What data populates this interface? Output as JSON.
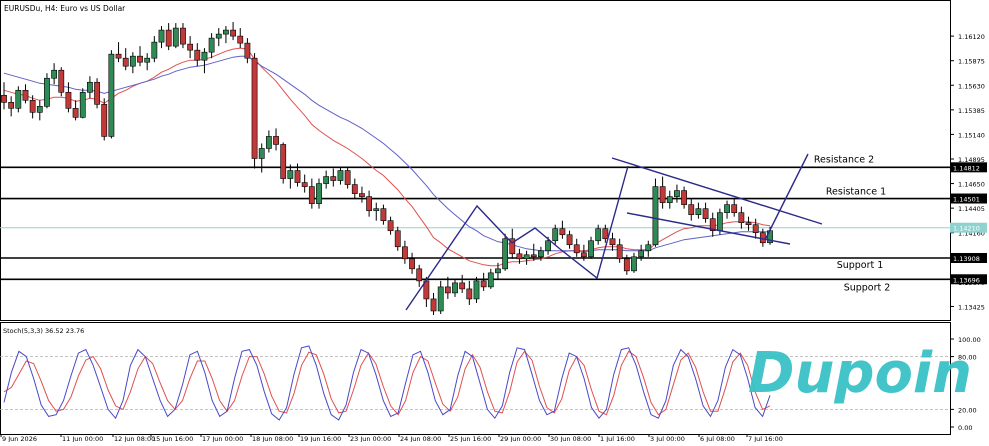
{
  "chart_data": {
    "type": "candlestick",
    "symbol_label": "EURUSDu, H4: Euro vs US Dollar",
    "price_axis": {
      "min": 1.1329,
      "max": 1.1646,
      "ticks": [
        "1.16120",
        "1.15875",
        "1.15630",
        "1.15385",
        "1.15140",
        "1.14895",
        "1.14650",
        "1.14405",
        "1.14160",
        "1.13915",
        "1.13670",
        "1.13425"
      ]
    },
    "x_labels": [
      "9 Jun 2026",
      "11 Jun 00:00",
      "12 Jun 08:00",
      "15 Jun 16:00",
      "17 Jun 00:00",
      "18 Jun 08:00",
      "19 Jun 16:00",
      "23 Jun 00:00",
      "24 Jun 08:00",
      "25 Jun 16:00",
      "29 Jun 00:00",
      "30 Jun 08:00",
      "1 Jul 16:00",
      "3 Jul 00:00",
      "6 Jul 08:00",
      "7 Jul 16:00"
    ],
    "levels": [
      {
        "name": "Resistance 2",
        "price": 1.14812,
        "label": "1.14812"
      },
      {
        "name": "Resistance 1",
        "price": 1.14501,
        "label": "1.14501"
      },
      {
        "name": "Support 1",
        "price": 1.13908,
        "label": "1.13908"
      },
      {
        "name": "Support 2",
        "price": 1.13696,
        "label": "1.13696"
      }
    ],
    "current_price": {
      "price": 1.1421,
      "label": "1.14210",
      "color": "#8fd3d0"
    },
    "candles_ohlc": [
      [
        1.1553,
        1.1566,
        1.1539,
        1.1546
      ],
      [
        1.1546,
        1.1552,
        1.1532,
        1.154
      ],
      [
        1.154,
        1.1562,
        1.1536,
        1.1558
      ],
      [
        1.1558,
        1.1564,
        1.1545,
        1.1548
      ],
      [
        1.1548,
        1.1553,
        1.153,
        1.1536
      ],
      [
        1.1536,
        1.1548,
        1.1528,
        1.1542
      ],
      [
        1.1542,
        1.1575,
        1.154,
        1.157
      ],
      [
        1.157,
        1.1585,
        1.1564,
        1.1578
      ],
      [
        1.1578,
        1.1581,
        1.1552,
        1.1556
      ],
      [
        1.1556,
        1.1566,
        1.1536,
        1.154
      ],
      [
        1.154,
        1.1548,
        1.1528,
        1.1531
      ],
      [
        1.1531,
        1.156,
        1.153,
        1.1556
      ],
      [
        1.1556,
        1.1572,
        1.155,
        1.1566
      ],
      [
        1.1566,
        1.157,
        1.154,
        1.1544
      ],
      [
        1.1544,
        1.155,
        1.1508,
        1.1512
      ],
      [
        1.1512,
        1.1598,
        1.151,
        1.1594
      ],
      [
        1.1594,
        1.1606,
        1.1586,
        1.159
      ],
      [
        1.159,
        1.16,
        1.1578,
        1.1582
      ],
      [
        1.1582,
        1.1596,
        1.1575,
        1.1592
      ],
      [
        1.1592,
        1.1602,
        1.1582,
        1.1586
      ],
      [
        1.1586,
        1.1595,
        1.1578,
        1.159
      ],
      [
        1.159,
        1.1612,
        1.1586,
        1.1606
      ],
      [
        1.1606,
        1.1622,
        1.16,
        1.1618
      ],
      [
        1.1618,
        1.1625,
        1.1598,
        1.1602
      ],
      [
        1.1602,
        1.1625,
        1.16,
        1.162
      ],
      [
        1.162,
        1.1625,
        1.16,
        1.1604
      ],
      [
        1.1604,
        1.1612,
        1.159,
        1.1598
      ],
      [
        1.1598,
        1.1605,
        1.1582,
        1.1588
      ],
      [
        1.1588,
        1.16,
        1.1575,
        1.1596
      ],
      [
        1.1596,
        1.1615,
        1.159,
        1.161
      ],
      [
        1.161,
        1.162,
        1.1602,
        1.1614
      ],
      [
        1.1614,
        1.1622,
        1.1605,
        1.1618
      ],
      [
        1.1618,
        1.1626,
        1.1608,
        1.1612
      ],
      [
        1.1612,
        1.162,
        1.16,
        1.1605
      ],
      [
        1.1605,
        1.161,
        1.1585,
        1.159
      ],
      [
        1.159,
        1.1595,
        1.148,
        1.149
      ],
      [
        1.149,
        1.1505,
        1.1476,
        1.15
      ],
      [
        1.15,
        1.1518,
        1.1496,
        1.1512
      ],
      [
        1.1512,
        1.152,
        1.1498,
        1.1504
      ],
      [
        1.1504,
        1.1506,
        1.1465,
        1.147
      ],
      [
        1.147,
        1.1484,
        1.146,
        1.1478
      ],
      [
        1.1478,
        1.1485,
        1.1462,
        1.1466
      ],
      [
        1.1466,
        1.1474,
        1.1456,
        1.1462
      ],
      [
        1.1462,
        1.147,
        1.144,
        1.1445
      ],
      [
        1.1445,
        1.147,
        1.144,
        1.1465
      ],
      [
        1.1465,
        1.1478,
        1.146,
        1.1472
      ],
      [
        1.1472,
        1.148,
        1.1462,
        1.1468
      ],
      [
        1.1468,
        1.1482,
        1.1464,
        1.1478
      ],
      [
        1.1478,
        1.1482,
        1.146,
        1.1464
      ],
      [
        1.1464,
        1.147,
        1.145,
        1.1455
      ],
      [
        1.1455,
        1.1462,
        1.1446,
        1.1452
      ],
      [
        1.1452,
        1.1458,
        1.1432,
        1.1438
      ],
      [
        1.1438,
        1.1446,
        1.1428,
        1.144
      ],
      [
        1.144,
        1.1444,
        1.1424,
        1.1428
      ],
      [
        1.1428,
        1.1432,
        1.1414,
        1.1418
      ],
      [
        1.1418,
        1.1422,
        1.1398,
        1.1402
      ],
      [
        1.1402,
        1.1408,
        1.1385,
        1.139
      ],
      [
        1.139,
        1.1396,
        1.1375,
        1.138
      ],
      [
        1.138,
        1.1384,
        1.1362,
        1.1368
      ],
      [
        1.1368,
        1.1372,
        1.1342,
        1.135
      ],
      [
        1.135,
        1.1356,
        1.1334,
        1.1338
      ],
      [
        1.1338,
        1.1368,
        1.1335,
        1.1362
      ],
      [
        1.1362,
        1.1372,
        1.135,
        1.1356
      ],
      [
        1.1356,
        1.137,
        1.1352,
        1.1366
      ],
      [
        1.1366,
        1.1374,
        1.1356,
        1.136
      ],
      [
        1.136,
        1.1368,
        1.1344,
        1.135
      ],
      [
        1.135,
        1.1372,
        1.1346,
        1.1368
      ],
      [
        1.1368,
        1.1376,
        1.1358,
        1.1362
      ],
      [
        1.1362,
        1.138,
        1.136,
        1.1376
      ],
      [
        1.1376,
        1.1386,
        1.137,
        1.138
      ],
      [
        1.138,
        1.1415,
        1.1378,
        1.141
      ],
      [
        1.141,
        1.142,
        1.139,
        1.1395
      ],
      [
        1.1395,
        1.14,
        1.1385,
        1.139
      ],
      [
        1.139,
        1.1398,
        1.1384,
        1.1394
      ],
      [
        1.1394,
        1.1405,
        1.1388,
        1.1392
      ],
      [
        1.1392,
        1.1402,
        1.1388,
        1.1398
      ],
      [
        1.1398,
        1.1412,
        1.1394,
        1.1408
      ],
      [
        1.1408,
        1.1424,
        1.1404,
        1.142
      ],
      [
        1.142,
        1.1428,
        1.141,
        1.1414
      ],
      [
        1.1414,
        1.1418,
        1.14,
        1.1404
      ],
      [
        1.1404,
        1.141,
        1.1392,
        1.1396
      ],
      [
        1.1396,
        1.1404,
        1.1388,
        1.1392
      ],
      [
        1.1392,
        1.1412,
        1.139,
        1.1408
      ],
      [
        1.1408,
        1.1424,
        1.1404,
        1.142
      ],
      [
        1.142,
        1.1424,
        1.1406,
        1.141
      ],
      [
        1.141,
        1.1416,
        1.1398,
        1.1404
      ],
      [
        1.1404,
        1.141,
        1.1386,
        1.139
      ],
      [
        1.139,
        1.1394,
        1.1374,
        1.1378
      ],
      [
        1.1378,
        1.1396,
        1.1376,
        1.1392
      ],
      [
        1.1392,
        1.1404,
        1.1388,
        1.1398
      ],
      [
        1.1398,
        1.1408,
        1.1392,
        1.1404
      ],
      [
        1.1404,
        1.147,
        1.1402,
        1.1462
      ],
      [
        1.1462,
        1.1472,
        1.144,
        1.1446
      ],
      [
        1.1446,
        1.1458,
        1.144,
        1.1452
      ],
      [
        1.1452,
        1.1464,
        1.1446,
        1.1458
      ],
      [
        1.1458,
        1.1462,
        1.144,
        1.1444
      ],
      [
        1.1444,
        1.145,
        1.1428,
        1.1434
      ],
      [
        1.1434,
        1.1446,
        1.143,
        1.144
      ],
      [
        1.144,
        1.1446,
        1.1426,
        1.143
      ],
      [
        1.143,
        1.1436,
        1.1412,
        1.1418
      ],
      [
        1.1418,
        1.144,
        1.1414,
        1.1436
      ],
      [
        1.1436,
        1.1448,
        1.143,
        1.1444
      ],
      [
        1.1444,
        1.145,
        1.1432,
        1.1436
      ],
      [
        1.1436,
        1.1442,
        1.142,
        1.1426
      ],
      [
        1.1426,
        1.1432,
        1.1418,
        1.1424
      ],
      [
        1.1424,
        1.143,
        1.141,
        1.1416
      ],
      [
        1.1416,
        1.142,
        1.1402,
        1.1406
      ],
      [
        1.1406,
        1.1422,
        1.1404,
        1.1418
      ]
    ],
    "moving_averages": [
      {
        "color": "#e05050",
        "values": [
          1.1558,
          1.1556,
          1.1554,
          1.1553,
          1.155,
          1.1548,
          1.1549,
          1.1551,
          1.1551,
          1.155,
          1.1547,
          1.1548,
          1.155,
          1.1549,
          1.1545,
          1.155,
          1.1555,
          1.1558,
          1.1562,
          1.1565,
          1.1567,
          1.1571,
          1.1576,
          1.1579,
          1.1583,
          1.1586,
          1.1588,
          1.1588,
          1.1589,
          1.1591,
          1.1594,
          1.1597,
          1.1599,
          1.16,
          1.1599,
          1.1589,
          1.1581,
          1.1574,
          1.1567,
          1.1558,
          1.1549,
          1.1541,
          1.1533,
          1.1524,
          1.1518,
          1.1513,
          1.1508,
          1.1504,
          1.15,
          1.1495,
          1.149,
          1.1484,
          1.1478,
          1.1473,
          1.1466,
          1.1459,
          1.145,
          1.1442,
          1.1432,
          1.1422,
          1.1411,
          1.1406,
          1.14,
          1.1396,
          1.1392,
          1.1388,
          1.1386,
          1.1384,
          1.1383,
          1.1383,
          1.1386,
          1.1387,
          1.1387,
          1.1388,
          1.1389,
          1.139,
          1.1392,
          1.1395,
          1.1397,
          1.1398,
          1.1398,
          1.1398,
          1.1399,
          1.1401,
          1.1402,
          1.1402,
          1.1402,
          1.14,
          1.1399,
          1.1399,
          1.1399,
          1.1405,
          1.1409,
          1.1413,
          1.1417,
          1.142,
          1.1421,
          1.1423,
          1.1423,
          1.1423,
          1.1424,
          1.1426,
          1.1427,
          1.1427,
          1.1427,
          1.1426,
          1.1424,
          1.1423
        ]
      },
      {
        "color": "#6060c8",
        "values": [
          1.1575,
          1.1573,
          1.1571,
          1.1569,
          1.1567,
          1.1565,
          1.1564,
          1.1563,
          1.1562,
          1.1561,
          1.1559,
          1.1558,
          1.1558,
          1.1557,
          1.1555,
          1.1557,
          1.1559,
          1.1561,
          1.1563,
          1.1565,
          1.1567,
          1.1569,
          1.1572,
          1.1574,
          1.1577,
          1.1579,
          1.1581,
          1.1582,
          1.1583,
          1.1585,
          1.1587,
          1.1589,
          1.1591,
          1.1592,
          1.1592,
          1.1587,
          1.1582,
          1.1578,
          1.1574,
          1.1569,
          1.1564,
          1.1559,
          1.1554,
          1.1548,
          1.1543,
          1.1539,
          1.1535,
          1.1531,
          1.1528,
          1.1524,
          1.152,
          1.1515,
          1.151,
          1.1505,
          1.1499,
          1.1493,
          1.1486,
          1.1479,
          1.1471,
          1.1463,
          1.1454,
          1.1447,
          1.144,
          1.1434,
          1.1428,
          1.1422,
          1.1418,
          1.1413,
          1.141,
          1.1407,
          1.1406,
          1.1404,
          1.1402,
          1.14,
          1.1399,
          1.1398,
          1.1398,
          1.1398,
          1.1398,
          1.1398,
          1.1398,
          1.1397,
          1.1398,
          1.1399,
          1.1399,
          1.1399,
          1.1399,
          1.1398,
          1.1398,
          1.1398,
          1.1398,
          1.1401,
          1.1403,
          1.1405,
          1.1407,
          1.1409,
          1.141,
          1.1411,
          1.1412,
          1.1413,
          1.1414,
          1.1415,
          1.1416,
          1.1417,
          1.1417,
          1.1417,
          1.1417,
          1.1417
        ]
      }
    ],
    "annotation_lines": [
      {
        "color": "#2a2a8a",
        "points": [
          [
            406,
            310
          ],
          [
            477,
            206
          ],
          [
            512,
            243
          ]
        ]
      },
      {
        "color": "#2a2a8a",
        "points": [
          [
            512,
            243
          ],
          [
            535,
            228
          ],
          [
            560,
            249
          ]
        ]
      },
      {
        "color": "#2a2a8a",
        "points": [
          [
            560,
            249
          ],
          [
            597,
            278
          ],
          [
            628,
            166
          ]
        ]
      },
      {
        "color": "#2a2a8a",
        "points": [
          [
            612,
            158
          ],
          [
            822,
            224
          ]
        ]
      },
      {
        "color": "#2a2a8a",
        "points": [
          [
            627,
            213
          ],
          [
            790,
            244
          ]
        ]
      },
      {
        "color": "#2a2a8a",
        "points": [
          [
            765,
            240
          ],
          [
            808,
            154
          ]
        ]
      }
    ],
    "stochastic": {
      "label": "Stoch(5,3,3) 36.52 23.76",
      "k_value": 36.52,
      "d_value": 23.76,
      "ticks": [
        "100.00",
        "80.00",
        "20.00",
        "0.00"
      ],
      "k_color": "#4848c8",
      "d_color": "#e05050",
      "k": [
        28,
        62,
        86,
        80,
        55,
        25,
        12,
        14,
        30,
        58,
        84,
        88,
        70,
        45,
        20,
        10,
        30,
        70,
        88,
        80,
        55,
        30,
        12,
        20,
        48,
        82,
        86,
        62,
        30,
        12,
        18,
        55,
        86,
        88,
        70,
        40,
        15,
        8,
        22,
        60,
        90,
        92,
        70,
        38,
        14,
        8,
        25,
        62,
        88,
        84,
        60,
        30,
        12,
        16,
        50,
        82,
        86,
        62,
        30,
        14,
        20,
        58,
        86,
        80,
        50,
        20,
        10,
        24,
        62,
        90,
        88,
        60,
        30,
        14,
        18,
        55,
        84,
        80,
        55,
        22,
        10,
        20,
        60,
        88,
        90,
        70,
        40,
        14,
        10,
        30,
        70,
        88,
        80,
        55,
        24,
        12,
        30,
        68,
        88,
        82,
        55,
        22,
        12,
        36
      ],
      "d": [
        40,
        45,
        60,
        75,
        72,
        52,
        30,
        18,
        20,
        34,
        58,
        76,
        80,
        66,
        42,
        24,
        20,
        40,
        66,
        80,
        72,
        50,
        30,
        20,
        30,
        55,
        75,
        75,
        55,
        30,
        18,
        30,
        58,
        80,
        80,
        60,
        35,
        18,
        16,
        38,
        70,
        85,
        82,
        60,
        32,
        16,
        18,
        42,
        70,
        84,
        72,
        46,
        24,
        14,
        30,
        62,
        80,
        75,
        50,
        26,
        18,
        34,
        66,
        82,
        68,
        40,
        18,
        16,
        40,
        74,
        86,
        76,
        46,
        22,
        16,
        32,
        64,
        80,
        70,
        42,
        18,
        14,
        36,
        70,
        86,
        80,
        56,
        28,
        14,
        20,
        48,
        76,
        84,
        68,
        40,
        18,
        18,
        44,
        74,
        84,
        70,
        40,
        20,
        24
      ]
    }
  },
  "watermark": {
    "text": "Dupoin",
    "color": "#39c1c6"
  }
}
